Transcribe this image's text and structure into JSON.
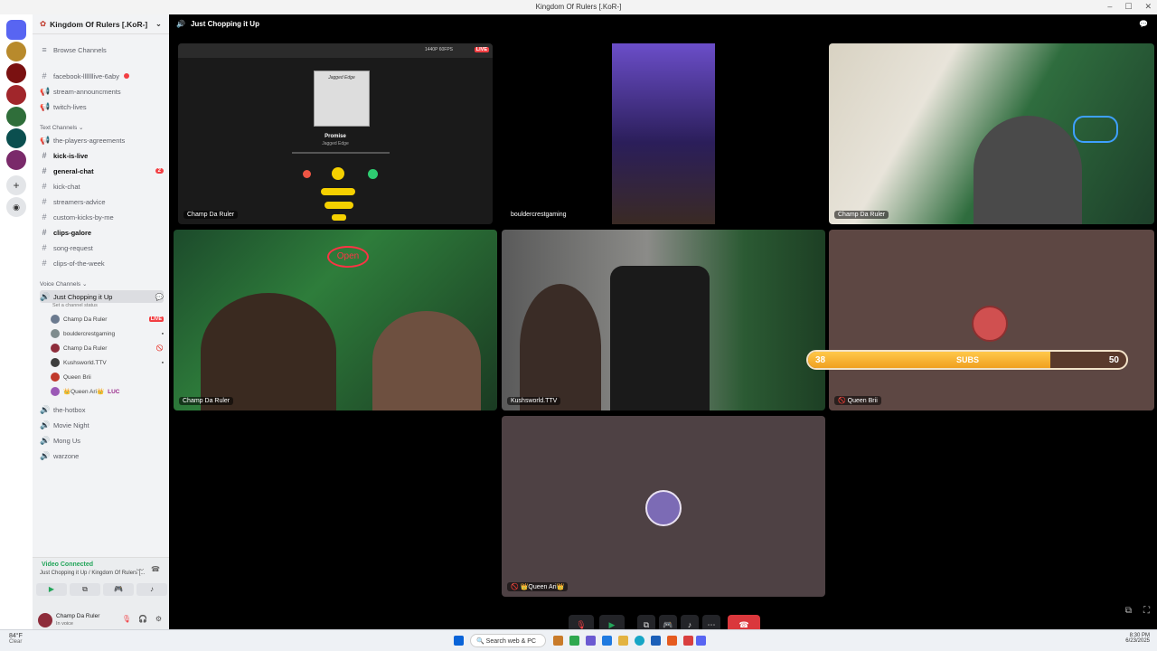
{
  "window": {
    "title": "Kingdom Of Rulers [.KoR-]"
  },
  "server": {
    "name": "Kingdom Of Rulers [.KoR-]"
  },
  "browse": "Browse Channels",
  "channels_top": [
    "facebook-lllllllive-6aby",
    "stream-announcments",
    "twitch-lives"
  ],
  "text_category": "Text Channels",
  "text_channels": [
    {
      "name": "the-players-agreements",
      "bold": false
    },
    {
      "name": "kick-is-live",
      "bold": true
    },
    {
      "name": "general-chat",
      "bold": true,
      "badge": "2"
    },
    {
      "name": "kick-chat",
      "bold": false
    },
    {
      "name": "streamers-advice",
      "bold": false
    },
    {
      "name": "custom-kicks-by-me",
      "bold": false
    },
    {
      "name": "clips-galore",
      "bold": true
    },
    {
      "name": "song-request",
      "bold": false
    },
    {
      "name": "clips-of-the-week",
      "bold": false
    }
  ],
  "voice_category": "Voice Channels",
  "voice_active": {
    "name": "Just Chopping it Up",
    "status": "Set a channel status"
  },
  "voice_users": [
    {
      "name": "Champ Da Ruler",
      "live": "LIVE"
    },
    {
      "name": "bouldercrestgaming"
    },
    {
      "name": "Champ Da Ruler"
    },
    {
      "name": "Kushsworld.TTV"
    },
    {
      "name": "Queen Brii"
    },
    {
      "name": "👑Queen Ari👑",
      "tag": "LUC"
    }
  ],
  "voice_other": [
    "the-hotbox",
    "Movie Night",
    "Mong Us",
    "warzone"
  ],
  "voice_status": {
    "connected": "Video Connected",
    "location": "Just Chopping it Up / Kingdom Of Rulers [..."
  },
  "user": {
    "name": "Champ Da Ruler",
    "status": "In voice"
  },
  "stage": {
    "channel": "Just Chopping it Up"
  },
  "tiles": [
    {
      "name": "Champ Da Ruler"
    },
    {
      "name": "bouldercrestgaming"
    },
    {
      "name": "Champ Da Ruler"
    },
    {
      "name": "Champ Da Ruler"
    },
    {
      "name": "Kushsworld.TTV"
    },
    {
      "name": "Queen Brii"
    },
    {
      "name": "👑Queen Ari👑"
    }
  ],
  "screenshare": {
    "song": "Promise",
    "artist": "Jagged Edge",
    "live": "LIVE",
    "quality": "1440P 60FPS",
    "album_text": "Jagged Edge"
  },
  "subs": {
    "current": "38",
    "label": "SUBS",
    "goal": "50",
    "fraction": 0.76
  },
  "taskbar": {
    "weather_temp": "84°F",
    "weather_desc": "Clear",
    "search": "Search web & PC",
    "time": "8:30 PM",
    "date": "6/23/2025"
  }
}
